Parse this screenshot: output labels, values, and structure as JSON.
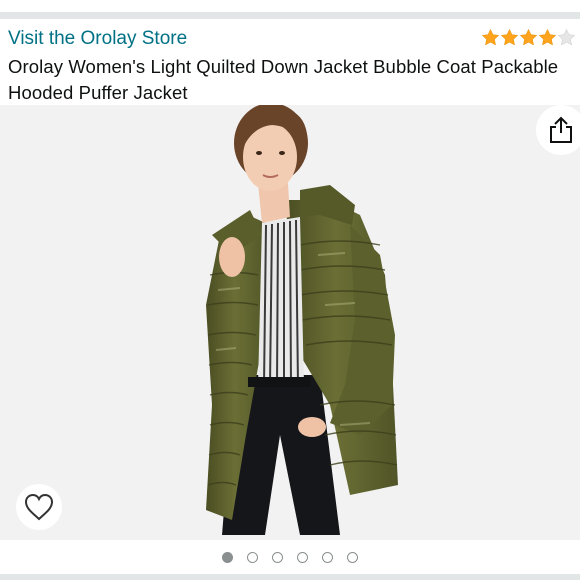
{
  "store": {
    "link_label": "Visit the Orolay Store"
  },
  "rating": {
    "stars": 4,
    "max": 5
  },
  "product": {
    "title": "Orolay Women's Light Quilted Down Jacket Bubble Coat Packable Hooded Puffer Jacket"
  },
  "icons": {
    "share": "share-icon",
    "wishlist": "heart-icon"
  },
  "carousel": {
    "count": 6,
    "active": 0
  },
  "colors": {
    "link": "#007185",
    "star": "#ffa41c",
    "jacket": "#5b5f2e"
  }
}
